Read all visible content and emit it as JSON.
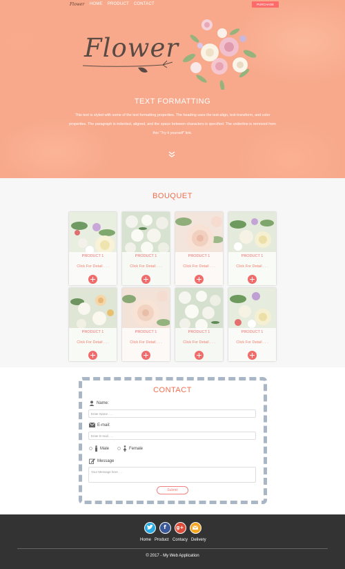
{
  "nav": {
    "brand": "Flower",
    "links": [
      "HOME",
      "PRODUCT",
      "CONTACT"
    ],
    "purchase_label": "PURCHASE"
  },
  "hero": {
    "logo_text": "Flower",
    "title": "TEXT FORMATTING",
    "paragraph": "This text is styled with some of the text formatting properties. The heading uses the text-align, text-transform, and color properties. The paragraph is indented, aligned, and the space between characters is specified. The underline is removed from this \"Try it yourself\" link."
  },
  "bouquet": {
    "title": "BOUQUET",
    "products": [
      {
        "name": "PRODUCT 1",
        "detail": "Click For Detail . . ."
      },
      {
        "name": "PRODUCT 1",
        "detail": "Click For Detail . . ."
      },
      {
        "name": "PRODUCT 1",
        "detail": "Click For Detail . . ."
      },
      {
        "name": "PRODUCT 1",
        "detail": "Click For Detail . . ."
      },
      {
        "name": "PRODUCT 1",
        "detail": "Click For Detail . . ."
      },
      {
        "name": "PRODUCT 1",
        "detail": "Click For Detail . . ."
      },
      {
        "name": "PRODUCT 1",
        "detail": "Click For Detail . . ."
      },
      {
        "name": "PRODUCT 1",
        "detail": "Click For Detail . . ."
      }
    ]
  },
  "contact": {
    "title": "CONTACT",
    "name_label": "Name:",
    "name_placeholder": "Enter Name . . .",
    "email_label": "E-mail:",
    "email_placeholder": "Enter E-mail . . .",
    "male_label": "Male",
    "female_label": "Female",
    "message_label": "Message",
    "message_placeholder": "Your Message here . . .",
    "submit_label": "Submit"
  },
  "footer": {
    "social_icons": [
      "twitter-icon",
      "facebook-icon",
      "google-plus-icon",
      "mail-icon"
    ],
    "social_colors": [
      "#29a9e1",
      "#3b5998",
      "#dd4b39",
      "#f5a623"
    ],
    "links": [
      "Home",
      "Product",
      "Contacy",
      "Delivery"
    ],
    "copyright": "© 2017 - My Web Application"
  },
  "colors": {
    "hero_bg": "#f8a98c",
    "accent": "#f06e4e",
    "footer_bg": "#333333"
  }
}
